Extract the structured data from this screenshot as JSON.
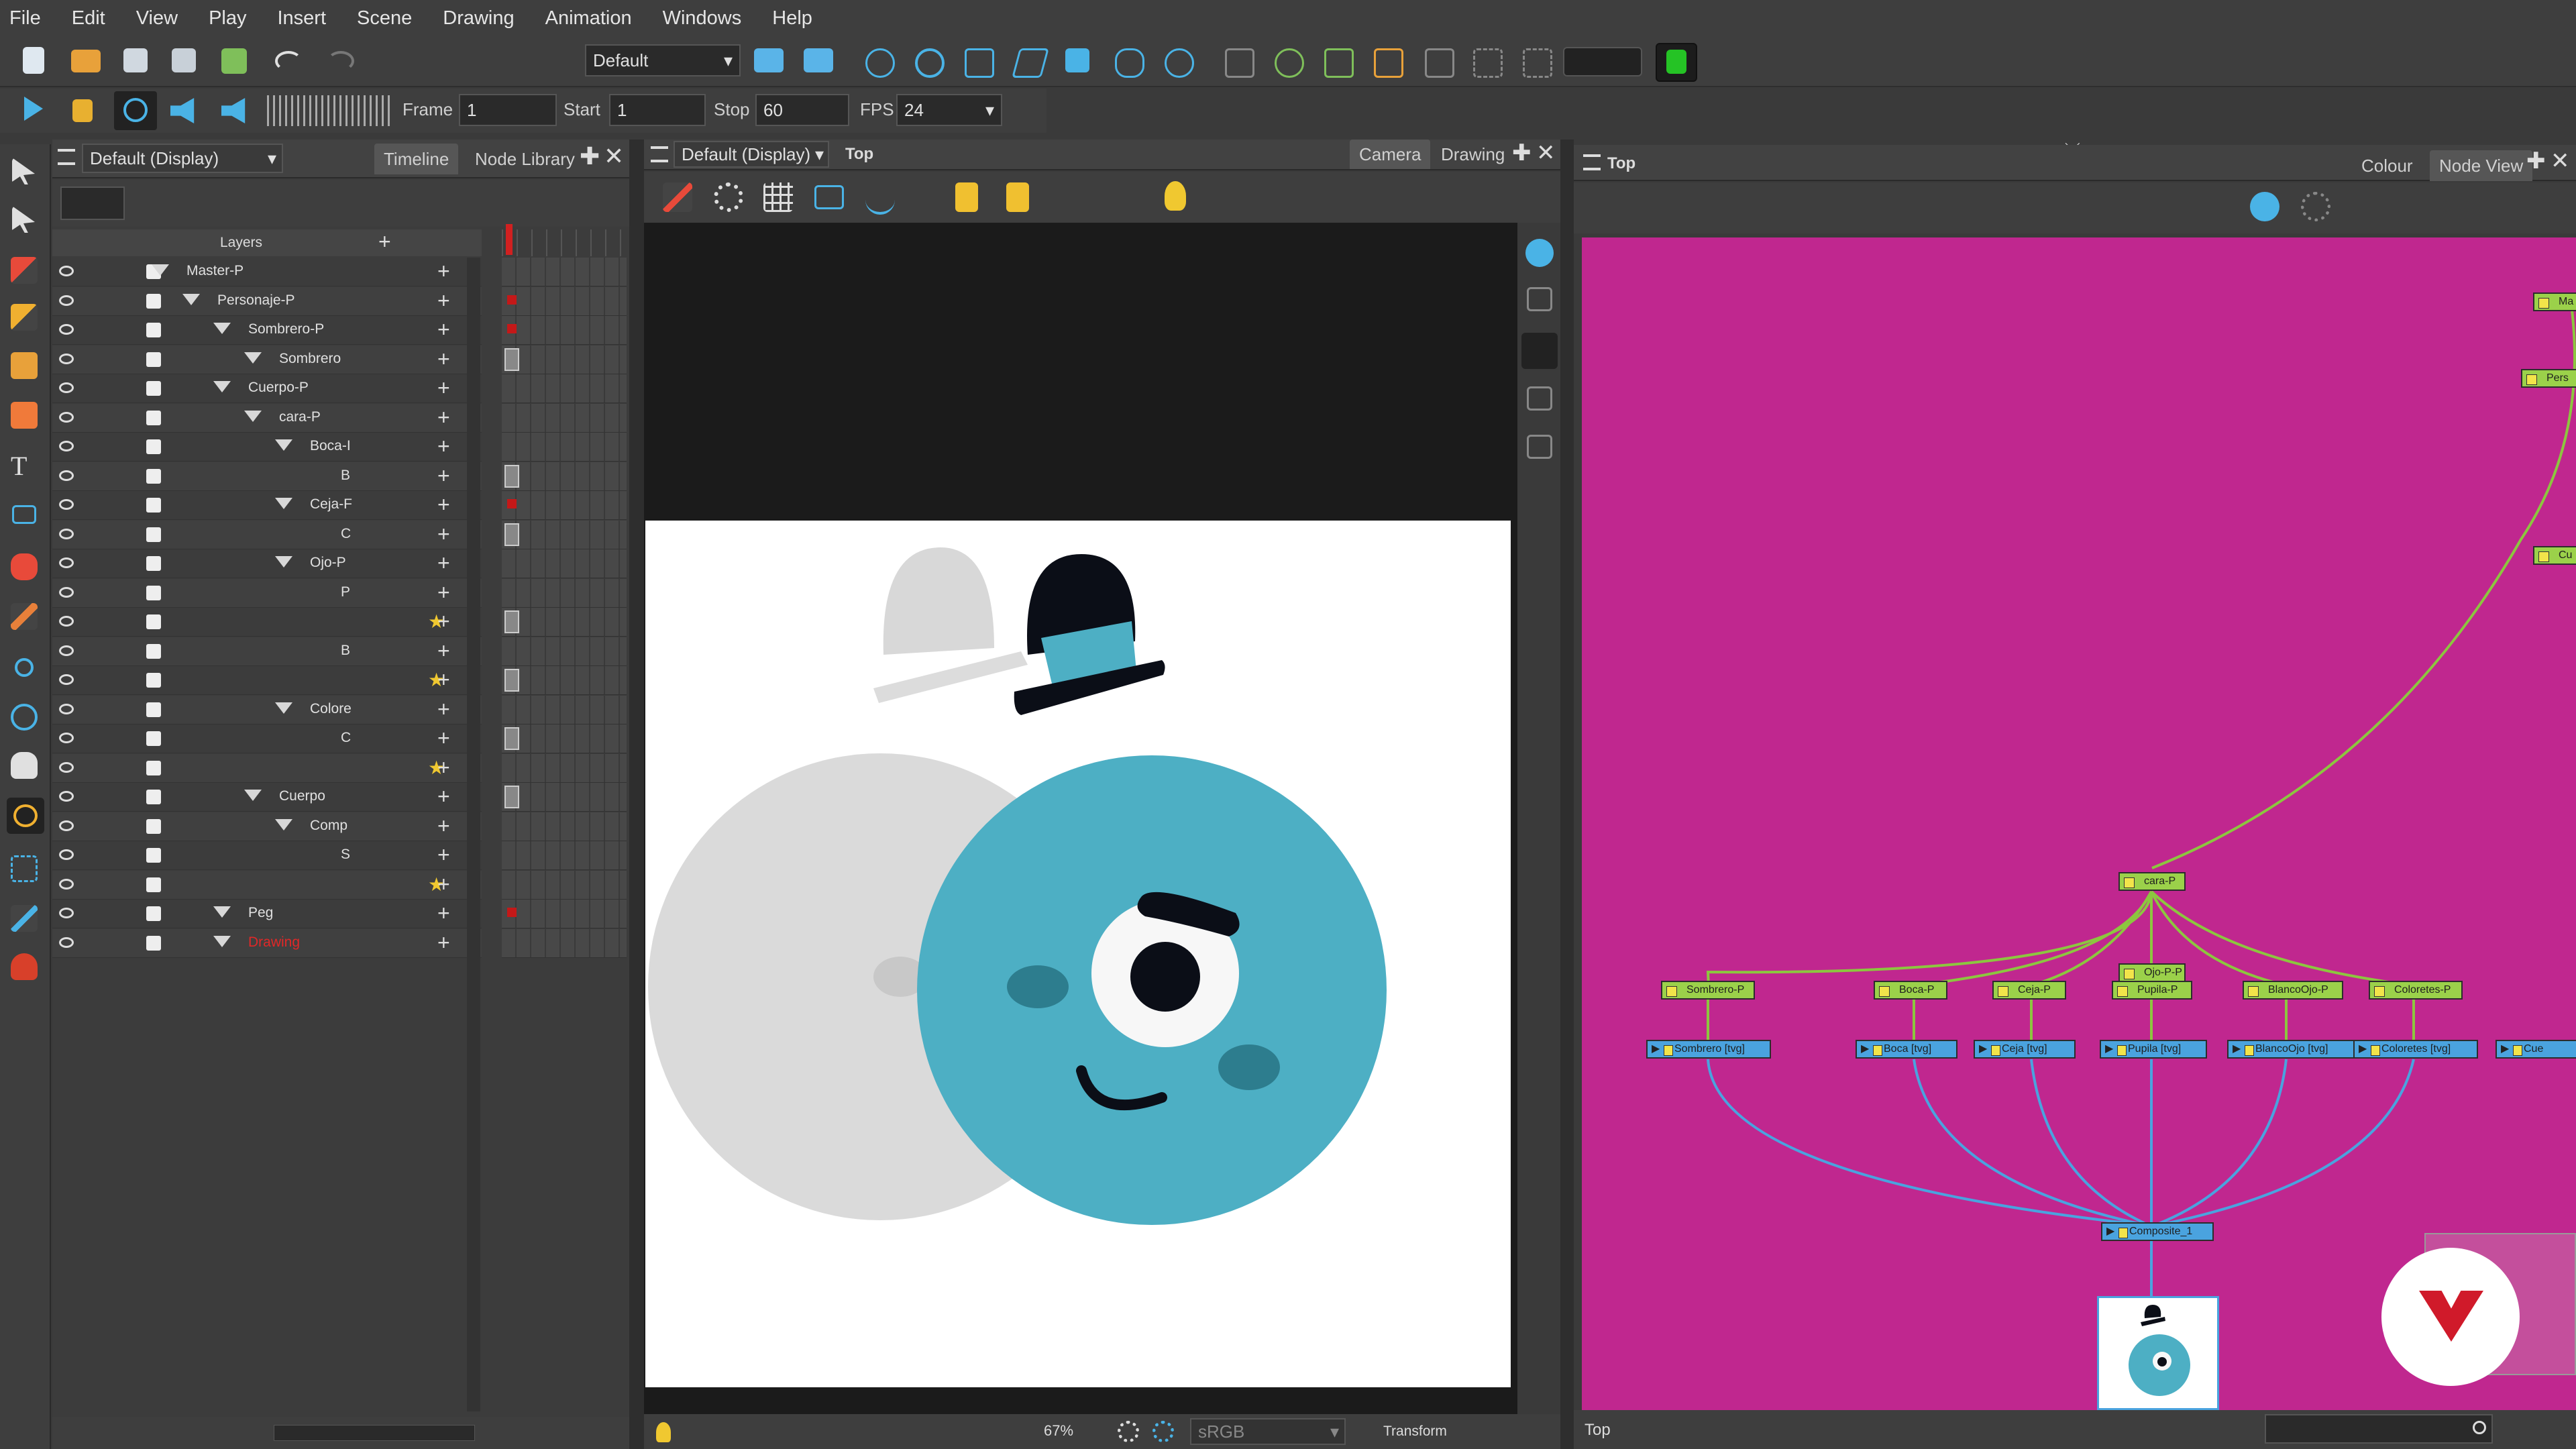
{
  "menu": [
    "File",
    "Edit",
    "View",
    "Play",
    "Insert",
    "Scene",
    "Drawing",
    "Animation",
    "Windows",
    "Help"
  ],
  "toolbar": {
    "workspace_value": "Default",
    "frame_label": "Frame",
    "frame_value": "1",
    "start_label": "Start",
    "start_value": "1",
    "stop_label": "Stop",
    "stop_value": "60",
    "fps_label": "FPS",
    "fps_value": "24"
  },
  "timeline_panel": {
    "view_select": "Default (Display)",
    "tabs": [
      "Timeline",
      "Node Library"
    ],
    "layers_header": "Layers",
    "layers": [
      {
        "name": "Master-P",
        "indent": 0
      },
      {
        "name": "Personaje-P",
        "indent": 1
      },
      {
        "name": "Sombrero-P",
        "indent": 2
      },
      {
        "name": "Sombrero",
        "indent": 3
      },
      {
        "name": "Cuerpo-P",
        "indent": 2
      },
      {
        "name": "cara-P",
        "indent": 3
      },
      {
        "name": "Boca-I",
        "indent": 4
      },
      {
        "name": "B",
        "indent": 5
      },
      {
        "name": "Ceja-F",
        "indent": 4
      },
      {
        "name": "C",
        "indent": 5
      },
      {
        "name": "Ojo-P",
        "indent": 4
      },
      {
        "name": "P",
        "indent": 5
      },
      {
        "name": "",
        "indent": 6
      },
      {
        "name": "B",
        "indent": 5
      },
      {
        "name": "",
        "indent": 6
      },
      {
        "name": "Colore",
        "indent": 4
      },
      {
        "name": "C",
        "indent": 5
      },
      {
        "name": "",
        "indent": 6
      },
      {
        "name": "Cuerpo",
        "indent": 3
      },
      {
        "name": "Comp",
        "indent": 4
      },
      {
        "name": "S",
        "indent": 5
      },
      {
        "name": "",
        "indent": 6
      },
      {
        "name": "Peg",
        "indent": 2
      },
      {
        "name": "Drawing",
        "indent": 2
      }
    ]
  },
  "camera_panel": {
    "view_select": "Default (Display)",
    "title": "Top",
    "tabs": [
      "Camera",
      "Drawing"
    ],
    "zoom": "67%",
    "colorspace": "sRGB",
    "mode": "Transform"
  },
  "node_panel": {
    "title": "Top",
    "tabs": [
      "Colour",
      "Node View"
    ],
    "footer": "Top",
    "nodes": {
      "cara": "cara-P",
      "ojo": "Ojo-P-P",
      "pegs": [
        "Sombrero-P",
        "Boca-P",
        "Ceja-P",
        "Pupila-P",
        "BlancoOjo-P",
        "Coloretes-P"
      ],
      "reads": [
        "Sombrero [tvg]",
        "Boca [tvg]",
        "Ceja [tvg]",
        "Pupila [tvg]",
        "BlancoOjo [tvg]",
        "Coloretes [tvg]"
      ],
      "composite": "Composite_1",
      "right_edge": [
        "Ma",
        "Pers",
        "Cu",
        "Cue"
      ]
    }
  },
  "colors": {
    "node_bg": "#c0278f",
    "peg_node": "#9bd14a",
    "read_node": "#4aa3df",
    "char_teal": "#4dafc4"
  }
}
